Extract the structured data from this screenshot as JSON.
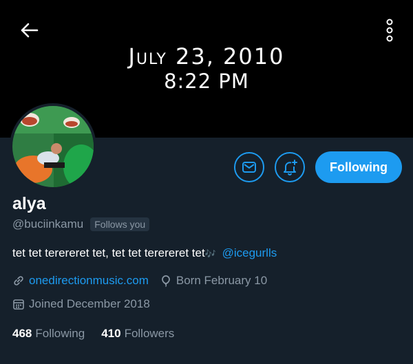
{
  "banner": {
    "date": "July 23, 2010",
    "time": "8:22 PM"
  },
  "profile": {
    "display_name": "alya",
    "handle": "@buciinkamu",
    "follows_you": "Follows you",
    "bio_text": "tet tet terereret tet, tet tet terereret tet",
    "bio_emoji": "🎶",
    "bio_mention": "@icegurlls",
    "website": "onedirectionmusic.com",
    "birthday": "Born February 10",
    "joined": "Joined December 2018"
  },
  "actions": {
    "follow_label": "Following"
  },
  "stats": {
    "following_count": "468",
    "following_label": "Following",
    "followers_count": "410",
    "followers_label": "Followers"
  },
  "icons": [
    "back-arrow-icon",
    "more-vertical-icon",
    "mail-icon",
    "bell-plus-icon",
    "link-icon",
    "balloon-icon",
    "calendar-icon"
  ],
  "colors": {
    "background": "#15202b",
    "accent": "#1d9bf0",
    "muted": "#8b98a5"
  }
}
